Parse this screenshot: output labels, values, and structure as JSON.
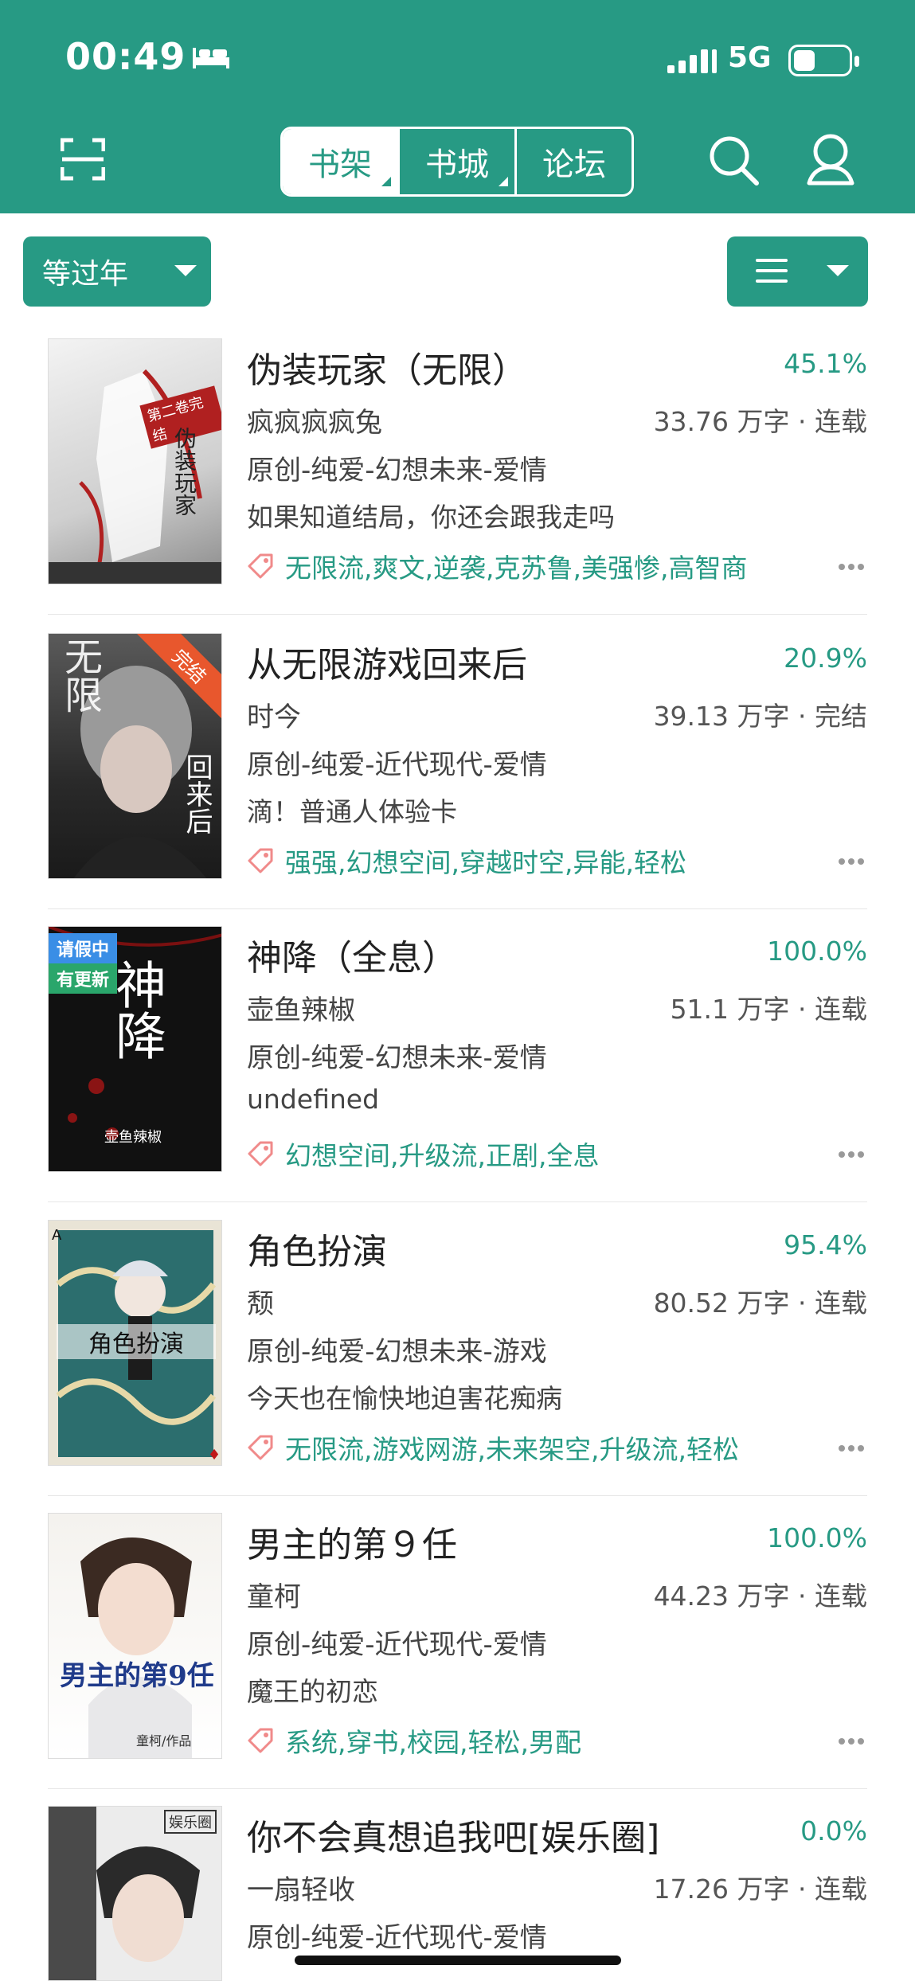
{
  "status": {
    "time": "00:49",
    "network": "5G"
  },
  "header": {
    "tabs": [
      {
        "label": "书架",
        "active": true,
        "dropdown": true
      },
      {
        "label": "书城",
        "active": false,
        "dropdown": true
      },
      {
        "label": "论坛",
        "active": false,
        "dropdown": false
      }
    ]
  },
  "toolbar": {
    "filter_label": "等过年"
  },
  "books": [
    {
      "title": "伪装玩家（无限）",
      "progress": "45.1%",
      "author": "疯疯疯疯兔",
      "meta": "33.76 万字 · 连载",
      "category": "原创-纯爱-幻想未来-爱情",
      "desc": "如果知道结局，你还会跟我走吗",
      "tags": "无限流,爽文,逆袭,克苏鲁,美强惨,高智商",
      "cover_text": "伪装玩家",
      "cover_ribbon": "第二卷完结"
    },
    {
      "title": "从无限游戏回来后",
      "progress": "20.9%",
      "author": "时今",
      "meta": "39.13 万字 · 完结",
      "category": "原创-纯爱-近代现代-爱情",
      "desc": "滴！普通人体验卡",
      "tags": "强强,幻想空间,穿越时空,异能,轻松",
      "cover_text": "无限",
      "cover_corner": "完结",
      "cover_side": "回来后"
    },
    {
      "title": "神降（全息）",
      "progress": "100.0%",
      "author": "壶鱼辣椒",
      "meta": "51.1 万字 · 连载",
      "category": "原创-纯爱-幻想未来-爱情",
      "desc": "undefined",
      "tags": "幻想空间,升级流,正剧,全息",
      "cover_text": "神降",
      "badge1": "请假中",
      "badge2": "有更新",
      "cover_author": "壶鱼辣椒"
    },
    {
      "title": "角色扮演",
      "progress": "95.4%",
      "author": "颓",
      "meta": "80.52 万字 · 连载",
      "category": "原创-纯爱-幻想未来-游戏",
      "desc": "今天也在愉快地迫害花痴病",
      "tags": "无限流,游戏网游,未来架空,升级流,轻松",
      "cover_text": "角色扮演"
    },
    {
      "title": "男主的第９任",
      "progress": "100.0%",
      "author": "童柯",
      "meta": "44.23 万字 · 连载",
      "category": "原创-纯爱-近代现代-爱情",
      "desc": "魔王的初恋",
      "tags": "系统,穿书,校园,轻松,男配",
      "cover_text": "男主的第9任",
      "cover_author": "童柯/作品"
    },
    {
      "title": "你不会真想追我吧[娱乐圈]",
      "progress": "0.0%",
      "author": "一扇轻收",
      "meta": "17.26 万字 · 连载",
      "category": "原创-纯爱-近代现代-爱情",
      "desc": "",
      "tags": "",
      "cover_text": "娱乐圈"
    }
  ]
}
